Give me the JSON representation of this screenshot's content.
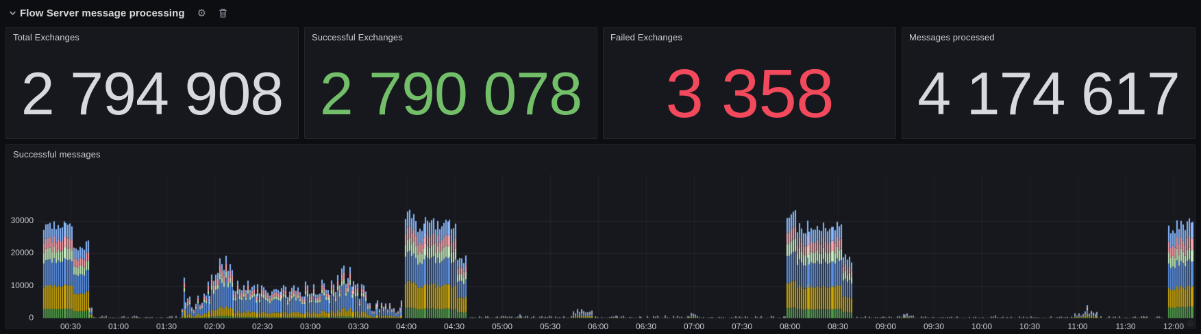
{
  "header": {
    "title": "Flow Server message processing",
    "collapse_icon": "chevron-down",
    "settings_icon": "gear",
    "delete_icon": "trash"
  },
  "stats": [
    {
      "title": "Total Exchanges",
      "value": "2 794 908",
      "color": "#d8d9de"
    },
    {
      "title": "Successful Exchanges",
      "value": "2 790 078",
      "color": "#73bf69"
    },
    {
      "title": "Failed Exchanges",
      "value": "3 358",
      "color": "#f2495c"
    },
    {
      "title": "Messages processed",
      "value": "4 174 617",
      "color": "#d8d9de"
    }
  ],
  "chart_panel": {
    "title": "Successful messages"
  },
  "chart_data": {
    "type": "bar",
    "stacked": true,
    "title": "Successful messages",
    "xlabel": "",
    "ylabel": "",
    "ylim": [
      0,
      35000
    ],
    "yticks": [
      0,
      10000,
      20000,
      30000
    ],
    "xticks": [
      "00:30",
      "01:00",
      "01:30",
      "02:00",
      "02:30",
      "03:00",
      "03:30",
      "04:00",
      "04:30",
      "05:00",
      "05:30",
      "06:00",
      "06:30",
      "07:00",
      "07:30",
      "08:00",
      "08:30",
      "09:00",
      "09:30",
      "10:00",
      "10:30",
      "11:00",
      "11:30",
      "12:00"
    ],
    "grid": true,
    "legend": "none",
    "x_minutes_range": [
      13,
      733
    ],
    "bar_interval_min": 1.25,
    "series": [
      {
        "name": "green",
        "color": "#4f9a48"
      },
      {
        "name": "dark-yellow",
        "color": "#c9a50b"
      },
      {
        "name": "blue",
        "color": "#5b8fe0"
      },
      {
        "name": "light-green",
        "color": "#c8f2c2"
      },
      {
        "name": "salmon",
        "color": "#ffa6b0"
      },
      {
        "name": "light-blue",
        "color": "#8ab8ff"
      }
    ],
    "mixes": {
      "default": [
        0.1,
        0.25,
        0.27,
        0.12,
        0.11,
        0.15
      ],
      "blueheavy": [
        0.04,
        0.16,
        0.45,
        0.1,
        0.13,
        0.12
      ],
      "burstD": [
        0.12,
        0.21,
        0.26,
        0.12,
        0.12,
        0.17
      ]
    },
    "spikes": [
      {
        "t": 100.5,
        "v": 12500
      },
      {
        "t": 127,
        "v": 19200
      },
      {
        "t": 200,
        "v": 16200
      },
      {
        "t": 666,
        "v": 4000
      }
    ],
    "envelope": [
      {
        "from": 13,
        "to": 31,
        "lo": 27000,
        "hi": 30000
      },
      {
        "from": 31,
        "to": 36,
        "lo": 18500,
        "hi": 22500
      },
      {
        "from": 36,
        "to": 41.5,
        "lo": 20500,
        "hi": 24000
      },
      {
        "from": 41.5,
        "to": 44,
        "lo": 2500,
        "hi": 6000
      },
      {
        "from": 44,
        "to": 99,
        "lo": 60,
        "hi": 800,
        "sparse": true
      },
      {
        "from": 99,
        "to": 112,
        "lo": 2500,
        "hi": 7500,
        "mix": "blueheavy"
      },
      {
        "from": 112,
        "to": 122,
        "lo": 6000,
        "hi": 14000,
        "mix": "blueheavy"
      },
      {
        "from": 122,
        "to": 131,
        "lo": 11000,
        "hi": 19000,
        "mix": "blueheavy"
      },
      {
        "from": 131,
        "to": 146,
        "lo": 7000,
        "hi": 12000,
        "mix": "blueheavy"
      },
      {
        "from": 146,
        "to": 176,
        "lo": 6500,
        "hi": 10500,
        "mix": "blueheavy"
      },
      {
        "from": 176,
        "to": 196,
        "lo": 7000,
        "hi": 12500,
        "mix": "blueheavy"
      },
      {
        "from": 196,
        "to": 209,
        "lo": 9000,
        "hi": 16000,
        "mix": "blueheavy"
      },
      {
        "from": 209,
        "to": 215,
        "lo": 5000,
        "hi": 11000,
        "mix": "blueheavy"
      },
      {
        "from": 215,
        "to": 238,
        "lo": 1500,
        "hi": 5500,
        "mix": "blueheavy"
      },
      {
        "from": 239,
        "to": 245,
        "lo": 29500,
        "hi": 33800
      },
      {
        "from": 245,
        "to": 263,
        "lo": 26500,
        "hi": 31500
      },
      {
        "from": 263,
        "to": 271,
        "lo": 27000,
        "hi": 30500
      },
      {
        "from": 271,
        "to": 277.5,
        "lo": 17000,
        "hi": 19500
      },
      {
        "from": 277.5,
        "to": 344,
        "lo": 60,
        "hi": 700,
        "sparse": true
      },
      {
        "from": 344,
        "to": 356,
        "lo": 1000,
        "hi": 3200
      },
      {
        "from": 356,
        "to": 418,
        "lo": 60,
        "hi": 800,
        "sparse": true
      },
      {
        "from": 418,
        "to": 421,
        "lo": 900,
        "hi": 1700
      },
      {
        "from": 421,
        "to": 477,
        "lo": 60,
        "hi": 700,
        "sparse": true
      },
      {
        "from": 478,
        "to": 484,
        "lo": 29500,
        "hi": 33800
      },
      {
        "from": 484,
        "to": 498,
        "lo": 26000,
        "hi": 30500
      },
      {
        "from": 498,
        "to": 506,
        "lo": 25500,
        "hi": 29500
      },
      {
        "from": 506,
        "to": 512,
        "lo": 27000,
        "hi": 29800
      },
      {
        "from": 512,
        "to": 518.5,
        "lo": 16500,
        "hi": 19800
      },
      {
        "from": 518.5,
        "to": 550,
        "lo": 60,
        "hi": 700,
        "sparse": true
      },
      {
        "from": 550,
        "to": 558,
        "lo": 600,
        "hi": 1800
      },
      {
        "from": 558,
        "to": 658,
        "lo": 50,
        "hi": 600,
        "sparse": true
      },
      {
        "from": 658,
        "to": 672,
        "lo": 700,
        "hi": 2400
      },
      {
        "from": 672,
        "to": 714,
        "lo": 60,
        "hi": 700,
        "sparse": true
      },
      {
        "from": 716,
        "to": 733,
        "lo": 26000,
        "hi": 30800,
        "mix": "burstD"
      }
    ]
  }
}
